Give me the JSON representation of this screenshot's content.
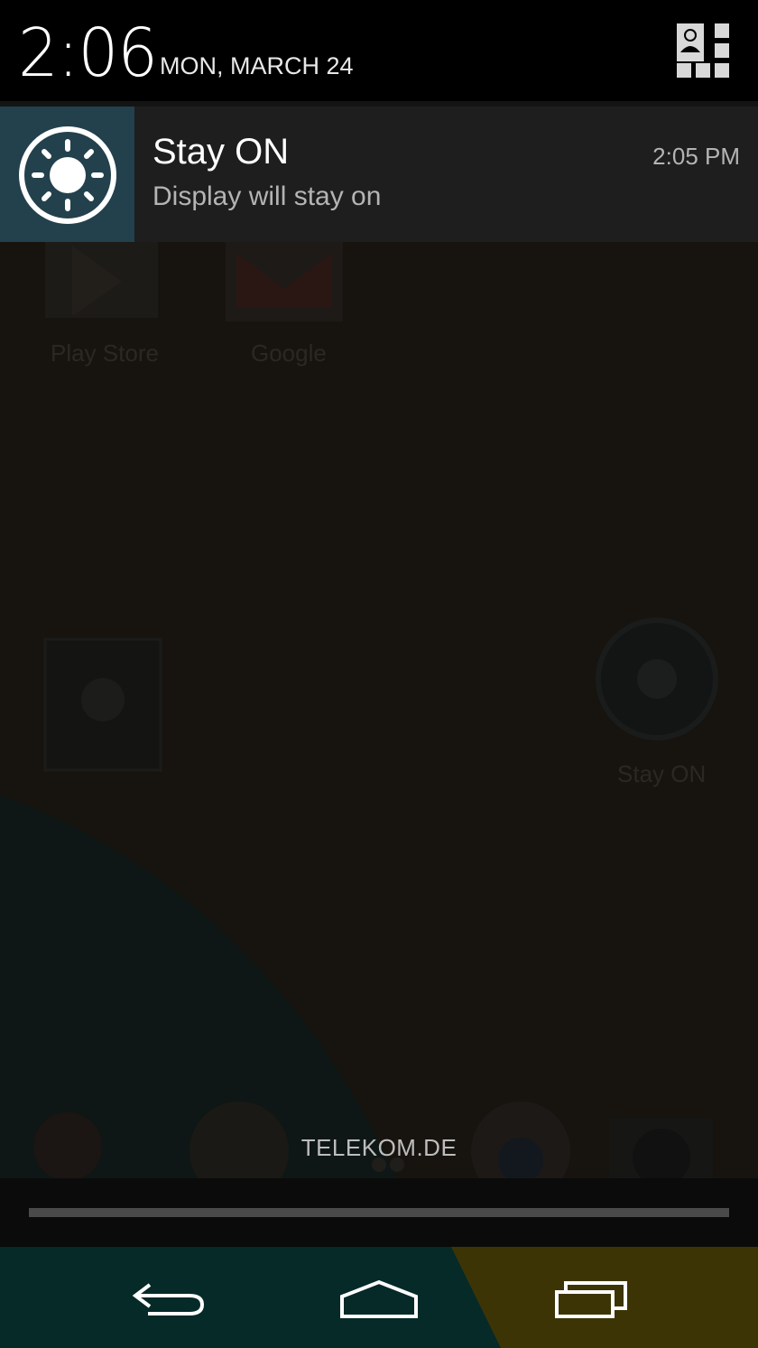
{
  "status": {
    "time": "2:06",
    "date": "MON, MARCH 24",
    "settings_icon": "quick-settings-icon"
  },
  "notification": {
    "icon": "sun-icon",
    "title": "Stay ON",
    "text": "Display will stay on",
    "time": "2:05 PM",
    "icon_bg": "#23414c"
  },
  "home": {
    "apps": [
      {
        "label": "Play Store",
        "icon": "play-store-icon"
      },
      {
        "label": "Google",
        "icon": "gmail-icon"
      },
      {
        "label": "Stay ON",
        "icon": "sun-icon"
      }
    ]
  },
  "carrier": "TELEKOM.DE",
  "navbar": {
    "back_icon": "back-icon",
    "home_icon": "home-icon",
    "recents_icon": "recents-icon"
  }
}
